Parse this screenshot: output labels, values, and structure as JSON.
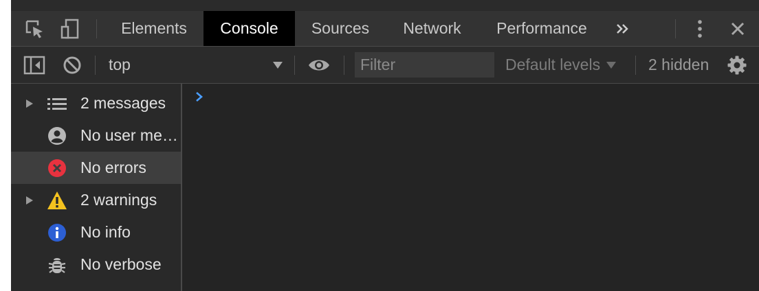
{
  "tabs": [
    {
      "label": "Elements",
      "active": false
    },
    {
      "label": "Console",
      "active": true
    },
    {
      "label": "Sources",
      "active": false
    },
    {
      "label": "Network",
      "active": false
    },
    {
      "label": "Performance",
      "active": false
    }
  ],
  "tabbar_icons": [
    "inspect-element-icon",
    "device-toolbar-icon",
    "more-tabs-icon",
    "kebab-menu-icon",
    "close-icon"
  ],
  "console_toolbar": {
    "context": "top",
    "filter_placeholder": "Filter",
    "levels": "Default levels",
    "hidden": "2 hidden"
  },
  "sidebar": {
    "items": [
      {
        "label": "2 messages",
        "icon": "list-icon",
        "expandable": true,
        "selected": false
      },
      {
        "label": "No user messages",
        "icon": "user-icon",
        "expandable": false,
        "selected": false
      },
      {
        "label": "No errors",
        "icon": "error-icon",
        "expandable": false,
        "selected": true
      },
      {
        "label": "2 warnings",
        "icon": "warning-icon",
        "expandable": true,
        "selected": false
      },
      {
        "label": "No info",
        "icon": "info-icon",
        "expandable": false,
        "selected": false
      },
      {
        "label": "No verbose",
        "icon": "bug-icon",
        "expandable": false,
        "selected": false
      }
    ]
  },
  "colors": {
    "accent_prompt": "#4a9eff",
    "error": "#e8323f",
    "warning": "#f4c21f",
    "info": "#2c5fd4"
  }
}
